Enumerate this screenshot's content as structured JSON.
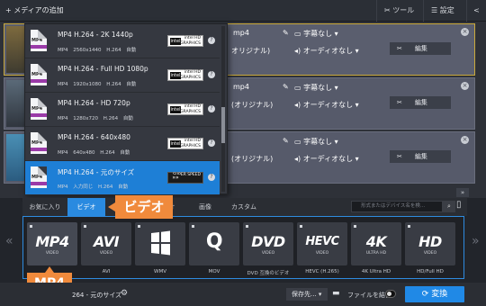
{
  "toolbar": {
    "add_media": "+ メディアの追加",
    "tools": "ツール",
    "settings": "設定"
  },
  "file_rows": [
    {
      "format": "mp4",
      "audio": "オリジナル)",
      "subtitle": "字幕なし",
      "audio_track": "オーディオなし",
      "edit": "編集"
    },
    {
      "format": "mp4",
      "audio": "(オリジナル)",
      "subtitle": "字幕なし",
      "audio_track": "オーディオなし",
      "edit": "編集"
    },
    {
      "format": "",
      "audio": "(オリジナル)",
      "subtitle": "字幕なし",
      "audio_track": "オーディオなし",
      "edit": "編集"
    }
  ],
  "presets": [
    {
      "title": "MP4 H.264 - 2K 1440p",
      "meta": "MP4 2560x1440 H.264 自動",
      "badge": "intel HD GRAPHICS",
      "active": false
    },
    {
      "title": "MP4 H.264 - Full HD 1080p",
      "meta": "MP4 1920x1080 H.264 自動",
      "badge": "intel HD GRAPHICS",
      "active": false
    },
    {
      "title": "MP4 H.264 - HD 720p",
      "meta": "MP4 1280x720 H.264 自動",
      "badge": "intel HD GRAPHICS",
      "active": false
    },
    {
      "title": "MP4 H.264 - 640x480",
      "meta": "MP4 640x480 H.264 自動",
      "badge": "intel HD GRAPHICS",
      "active": false
    },
    {
      "title": "MP4 H.264 - 元のサイズ",
      "meta": "MP4 入力同じ H.264 自動",
      "badge": "SUPER SPEED",
      "active": true
    }
  ],
  "preset_icon_text": "MP4",
  "tabs": {
    "favorites": "お気に入り",
    "video": "ビデオ",
    "audio": "オ",
    "images": "画像",
    "custom": "カスタム"
  },
  "search_placeholder": "形式またはデバイス名を検...",
  "callouts": {
    "video": "ビデオ",
    "mp4": "MP4"
  },
  "formats": [
    {
      "logo": "MP4",
      "sub": "VIDEO",
      "caption": "",
      "selected": true
    },
    {
      "logo": "AVI",
      "sub": "VIDEO",
      "caption": "AVI",
      "selected": false
    },
    {
      "logo": "",
      "sub": "",
      "caption": "WMV",
      "selected": false
    },
    {
      "logo": "Q",
      "sub": "",
      "caption": "MOV",
      "selected": false
    },
    {
      "logo": "DVD",
      "sub": "VIDEO",
      "caption": "DVD 互換のビデオ",
      "selected": false
    },
    {
      "logo": "HEVC",
      "sub": "VIDEO",
      "caption": "HEVC (H.265)",
      "selected": false
    },
    {
      "logo": "4K",
      "sub": "ULTRA HD",
      "caption": "4K Ultra HD",
      "selected": false
    },
    {
      "logo": "HD",
      "sub": "VIDEO",
      "caption": "HD/Full HD",
      "selected": false
    }
  ],
  "bottom": {
    "output_format": "264 - 元のサイズ",
    "save_to": "保存先...",
    "join_files": "ファイルを結合",
    "convert": "変換"
  }
}
